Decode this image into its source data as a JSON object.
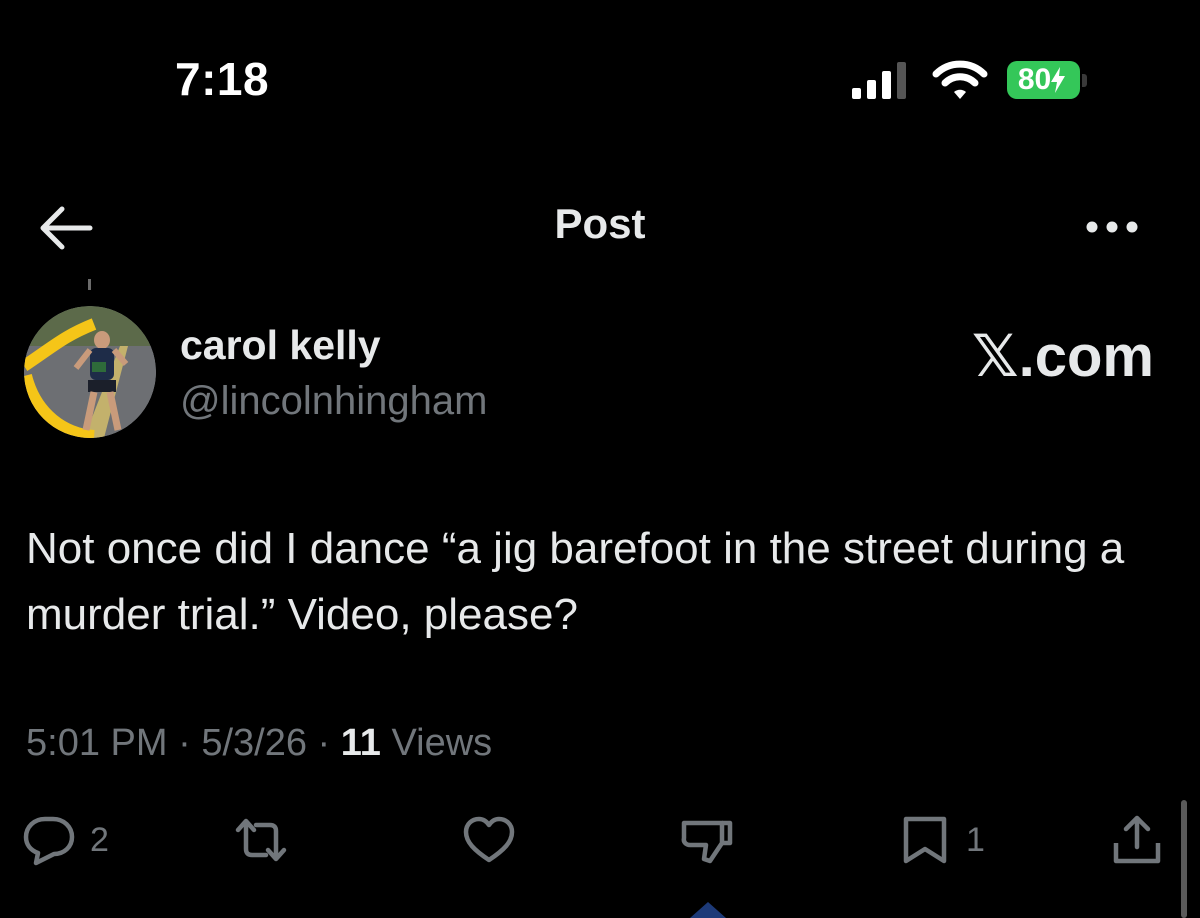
{
  "status_bar": {
    "time": "7:18",
    "battery_level": "80",
    "battery_color": "#34c759",
    "icons": [
      "cellular-signal-icon",
      "wifi-icon",
      "battery-charging-icon"
    ]
  },
  "header": {
    "title": "Post",
    "back_icon": "arrow-left-icon",
    "more_icon": "more-horizontal-icon"
  },
  "author": {
    "name": "carol kelly",
    "handle": "@lincolnhingham"
  },
  "watermark": "𝕏.com",
  "post": {
    "text": "Not once did I dance “a jig barefoot in the street during a murder trial.” Video, please?"
  },
  "meta": {
    "time": "5:01 PM",
    "separator": " · ",
    "date": "5/3/26",
    "views_count": "11",
    "views_label": " Views"
  },
  "actions": {
    "reply_count": "2",
    "bookmark_count": "1",
    "icons": [
      "reply-icon",
      "repost-icon",
      "like-icon",
      "dislike-icon",
      "bookmark-icon",
      "share-icon"
    ]
  },
  "colors": {
    "background": "#000000",
    "text_primary": "#e7e9ea",
    "text_secondary": "#71767b"
  }
}
